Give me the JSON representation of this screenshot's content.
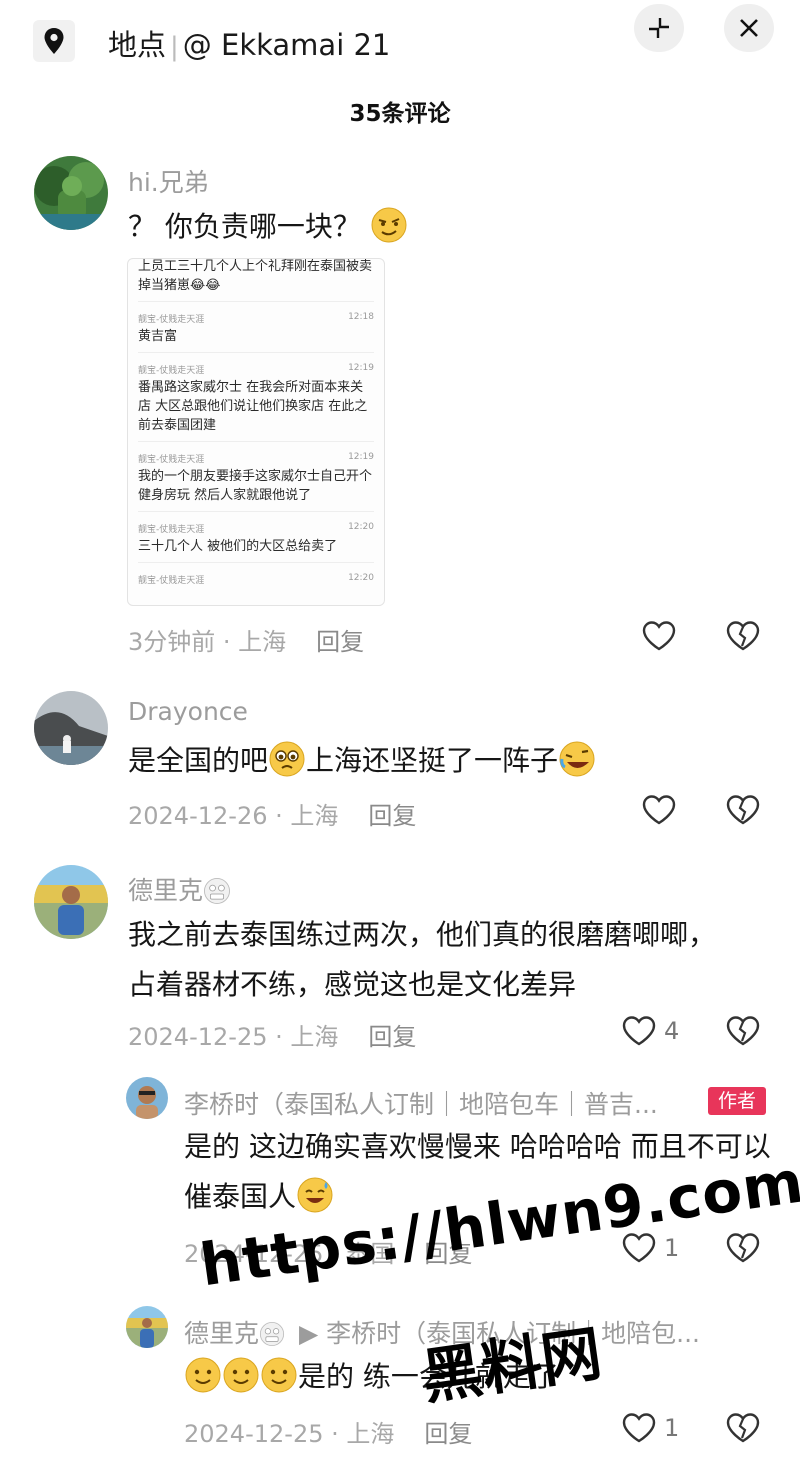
{
  "header": {
    "location_label": "地点",
    "location_name": "@ Ekkamai 21",
    "title": "35条评论"
  },
  "comments": [
    {
      "username": "hi.兄弟",
      "text": "？ 你负责哪一块？",
      "time": "3分钟前",
      "location": "上海",
      "reply": "回复",
      "likes": "",
      "screenshot": [
        {
          "sender": "",
          "time": "",
          "text": "上员工三十几个人上个礼拜刚在泰国被卖掉当猪崽😂😂"
        },
        {
          "sender": "靓宝-仗贱走天涯",
          "time": "12:18",
          "text": "黄吉富"
        },
        {
          "sender": "靓宝-仗贱走天涯",
          "time": "12:19",
          "text": "番禺路这家威尔士 在我会所对面本来关店 大区总跟他们说让他们换家店 在此之前去泰国团建"
        },
        {
          "sender": "靓宝-仗贱走天涯",
          "time": "12:19",
          "text": "我的一个朋友要接手这家威尔士自己开个健身房玩 然后人家就跟他说了"
        },
        {
          "sender": "靓宝-仗贱走天涯",
          "time": "12:20",
          "text": "三十几个人 被他们的大区总给卖了"
        },
        {
          "sender": "靓宝-仗贱走天涯",
          "time": "12:20",
          "text": ""
        }
      ]
    },
    {
      "username": "Drayonce",
      "text_a": "是全国的吧",
      "text_b": "上海还坚挺了一阵子",
      "time": "2024-12-26",
      "location": "上海",
      "reply": "回复",
      "likes": ""
    },
    {
      "username": "德里克",
      "text": "我之前去泰国练过两次，他们真的很磨磨唧唧，占着器材不练，感觉这也是文化差异",
      "time": "2024-12-25",
      "location": "上海",
      "reply": "回复",
      "likes": "4"
    },
    {
      "username": "李桥时（泰国私人订制｜地陪包车｜普吉...",
      "badge": "作者",
      "text": "是的 这边确实喜欢慢慢来 哈哈哈哈 而且不可以催泰国人",
      "time": "2024-12-25",
      "location": "泰国",
      "reply": "回复",
      "likes": "1"
    },
    {
      "username": "德里克",
      "reply_to": "▶ 李桥时（泰国私人订制｜地陪包...",
      "text": "是的 练一会儿就走了",
      "time": "2024-12-25",
      "location": "上海",
      "reply": "回复",
      "likes": "1"
    }
  ],
  "watermark": {
    "url": "https://hlwn9.com",
    "name": "黑料网"
  },
  "icons": [
    "location-pin-icon",
    "collapse-icon",
    "close-icon",
    "heart-icon",
    "broken-heart-icon"
  ]
}
